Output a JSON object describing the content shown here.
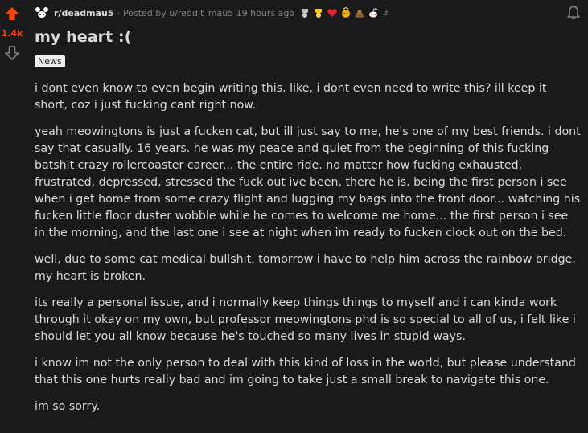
{
  "vote": {
    "score": "1.4k"
  },
  "meta": {
    "subreddit": "r/deadmau5",
    "separator": "·",
    "posted_by": "Posted by u/reddit_mau5 19 hours ago",
    "award_icons": [
      "silver-award-icon",
      "gold-award-icon",
      "heart-award-icon",
      "wholesome-award-icon",
      "poop-award-icon",
      "snoo-award-icon"
    ],
    "award_count": "3"
  },
  "post": {
    "title": "my heart :(",
    "flair": "News",
    "paragraphs": [
      "i dont even know to even begin writing this. like, i dont even need to write this? ill keep it short, coz i just fucking cant right now.",
      "yeah meowingtons is just a fucken cat, but ill just say to me, he's one of my best friends. i dont say that casually. 16 years. he was my peace and quiet from the beginning of this fucking batshit crazy rollercoaster career... the entire ride.  no matter how fucking exhausted, frustrated, depressed, stressed the fuck out ive been, there he is. being the first person i see when i get home from some crazy flight and lugging my bags into the front door... watching his fucken little floor duster wobble while he comes to welcome me home... the first person i see in the morning, and the last one i see at night when im ready to fucken clock out on the bed.",
      "well, due to some cat medical bullshit, tomorrow i have to help him across the rainbow bridge. my heart is broken.",
      "its really a personal issue, and i normally keep things things to myself and i can kinda work through it okay on my own, but professor meowingtons phd is so special to all of us, i felt like i should let you all know because he's touched so many lives in stupid ways.",
      "i know im not the only person to deal with this kind of loss in the world, but please understand that this one hurts really bad and im going to take just a small break to navigate this one.",
      "im so sorry."
    ]
  },
  "colors": {
    "background": "#1a1a1b",
    "text": "#d7dadc",
    "muted": "#818384",
    "upvote": "#ff4500"
  }
}
